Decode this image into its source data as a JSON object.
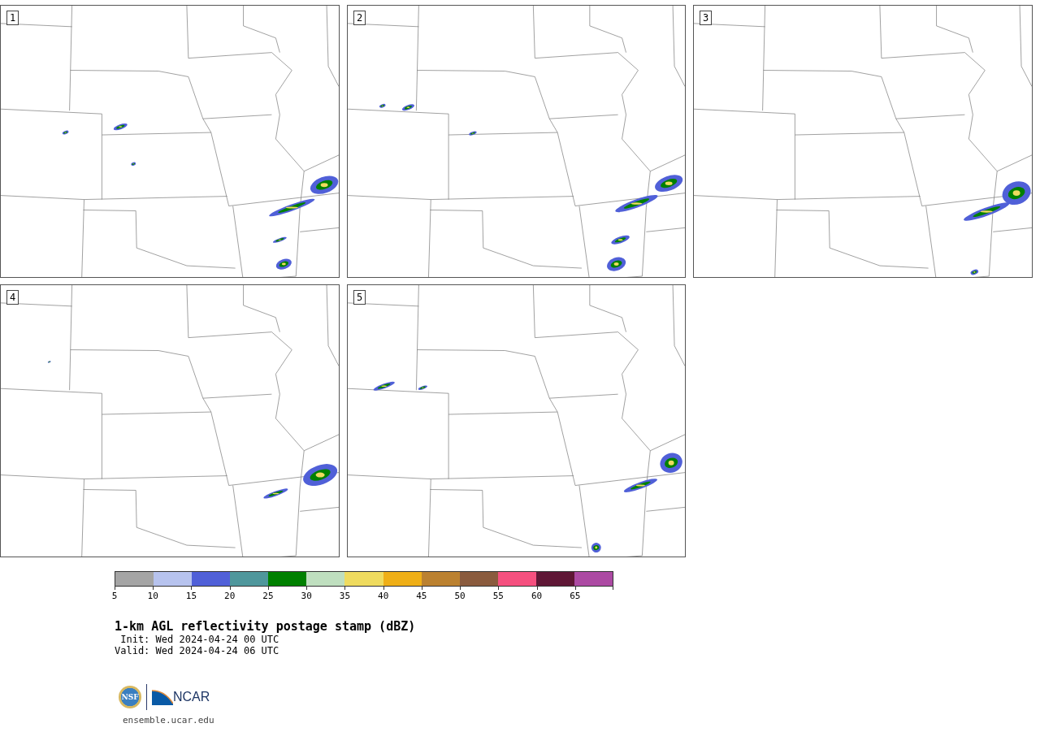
{
  "panels": [
    {
      "label": "1"
    },
    {
      "label": "2"
    },
    {
      "label": "3"
    },
    {
      "label": "4"
    },
    {
      "label": "5"
    }
  ],
  "colorbar": {
    "segments": [
      {
        "color": "#a5a5a5",
        "label": "5"
      },
      {
        "color": "#b7c3ee",
        "label": "10"
      },
      {
        "color": "#5060d8",
        "label": "15"
      },
      {
        "color": "#4f979c",
        "label": "20"
      },
      {
        "color": "#008000",
        "label": "25"
      },
      {
        "color": "#bfdfbf",
        "label": "30"
      },
      {
        "color": "#efdb5f",
        "label": "35"
      },
      {
        "color": "#efaf17",
        "label": "40"
      },
      {
        "color": "#bb8130",
        "label": "45"
      },
      {
        "color": "#8a5b3e",
        "label": "50"
      },
      {
        "color": "#f5507f",
        "label": "55"
      },
      {
        "color": "#5f1736",
        "label": "60"
      },
      {
        "color": "#ac4aa3",
        "label": "65"
      }
    ]
  },
  "title": "1-km AGL reflectivity postage stamp (dBZ)",
  "init": " Init: Wed 2024-04-24 00 UTC",
  "valid": "Valid: Wed 2024-04-24 06 UTC",
  "logo": {
    "nsf": "NSF",
    "ncar": "NCAR"
  },
  "footer": "ensemble.ucar.edu"
}
